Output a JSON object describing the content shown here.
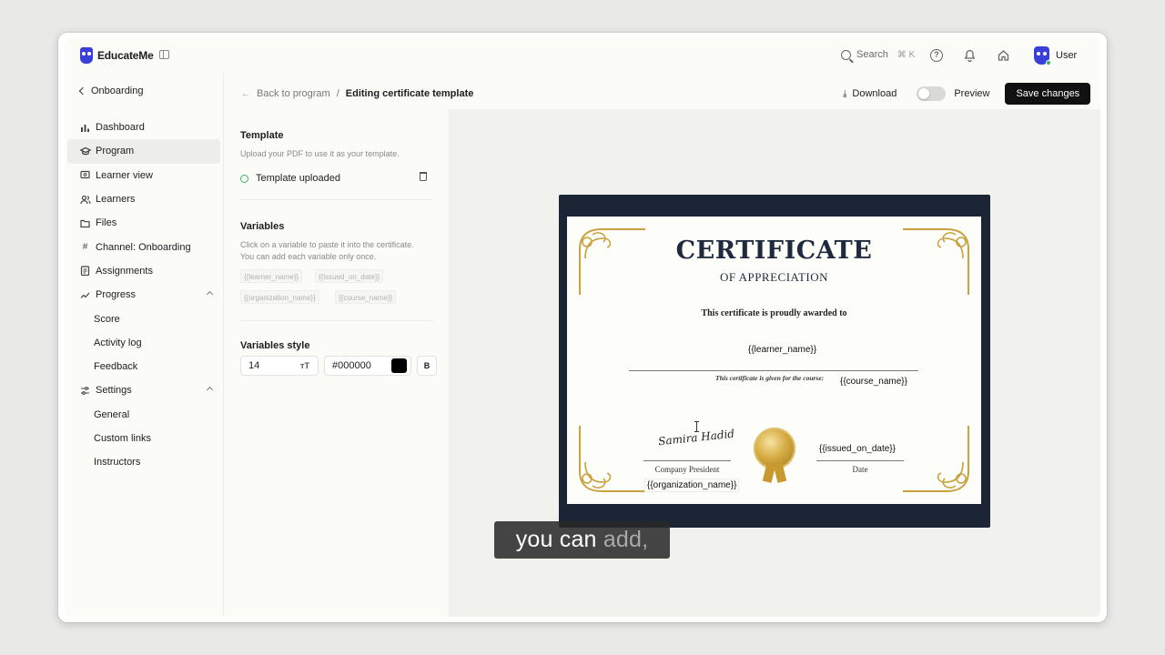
{
  "app": {
    "logo_text": "EducateMe"
  },
  "topbar": {
    "search_label": "Search",
    "search_shortcut": "⌘ K",
    "user_label": "User"
  },
  "sidebar": {
    "back_label": "Onboarding",
    "items": [
      {
        "label": "Dashboard",
        "icon": "bar-chart-icon"
      },
      {
        "label": "Program",
        "icon": "graduation-cap-icon",
        "active": true
      },
      {
        "label": "Learner view",
        "icon": "monitor-icon"
      },
      {
        "label": "Learners",
        "icon": "users-icon"
      },
      {
        "label": "Files",
        "icon": "folder-icon"
      },
      {
        "label": "Channel: Onboarding",
        "icon": "hash-icon"
      },
      {
        "label": "Assignments",
        "icon": "clipboard-icon"
      },
      {
        "label": "Progress",
        "icon": "trend-icon",
        "expanded": true
      },
      {
        "label": "Score",
        "sub": true
      },
      {
        "label": "Activity log",
        "sub": true
      },
      {
        "label": "Feedback",
        "sub": true
      },
      {
        "label": "Settings",
        "icon": "sliders-icon",
        "expanded": true
      },
      {
        "label": "General",
        "sub": true
      },
      {
        "label": "Custom links",
        "sub": true
      },
      {
        "label": "Instructors",
        "sub": true
      }
    ]
  },
  "header": {
    "back_link": "Back to program",
    "separator": "/",
    "current": "Editing certificate template",
    "download_label": "Download",
    "preview_label": "Preview",
    "save_label": "Save changes"
  },
  "panel": {
    "template_title": "Template",
    "template_hint": "Upload your PDF to use it as your template.",
    "uploaded_label": "Template uploaded",
    "variables_title": "Variables",
    "variables_hint_1": "Click on a variable to paste it into the certificate.",
    "variables_hint_2": "You can add each variable only once.",
    "variables": [
      "{{learner_name}}",
      "{{issued_on_date}}",
      "{{organization_name}}",
      "{{course_name}}"
    ],
    "style_title": "Variables style",
    "font_size": "14",
    "font_size_icon_text": "тT",
    "color_value": "#000000",
    "bold_label": "B"
  },
  "certificate": {
    "title": "CERTIFICATE",
    "subtitle": "OF APPRECIATION",
    "awarded_text": "This certificate is proudly awarded to",
    "learner_var": "{{learner_name}}",
    "course_note": "This certificate is given for the course:",
    "course_var": "{{course_name}}",
    "date_var": "{{issued_on_date}}",
    "president_label": "Company President",
    "date_label": "Date",
    "org_var": "{{organization_name}}",
    "signature_text": "Samira Hadid"
  },
  "caption": {
    "text_main": "you can ",
    "text_dim": "add,"
  },
  "colors": {
    "accent": "#3b3fd9",
    "frame": "#1b2536",
    "gold": "#d4a93f"
  }
}
